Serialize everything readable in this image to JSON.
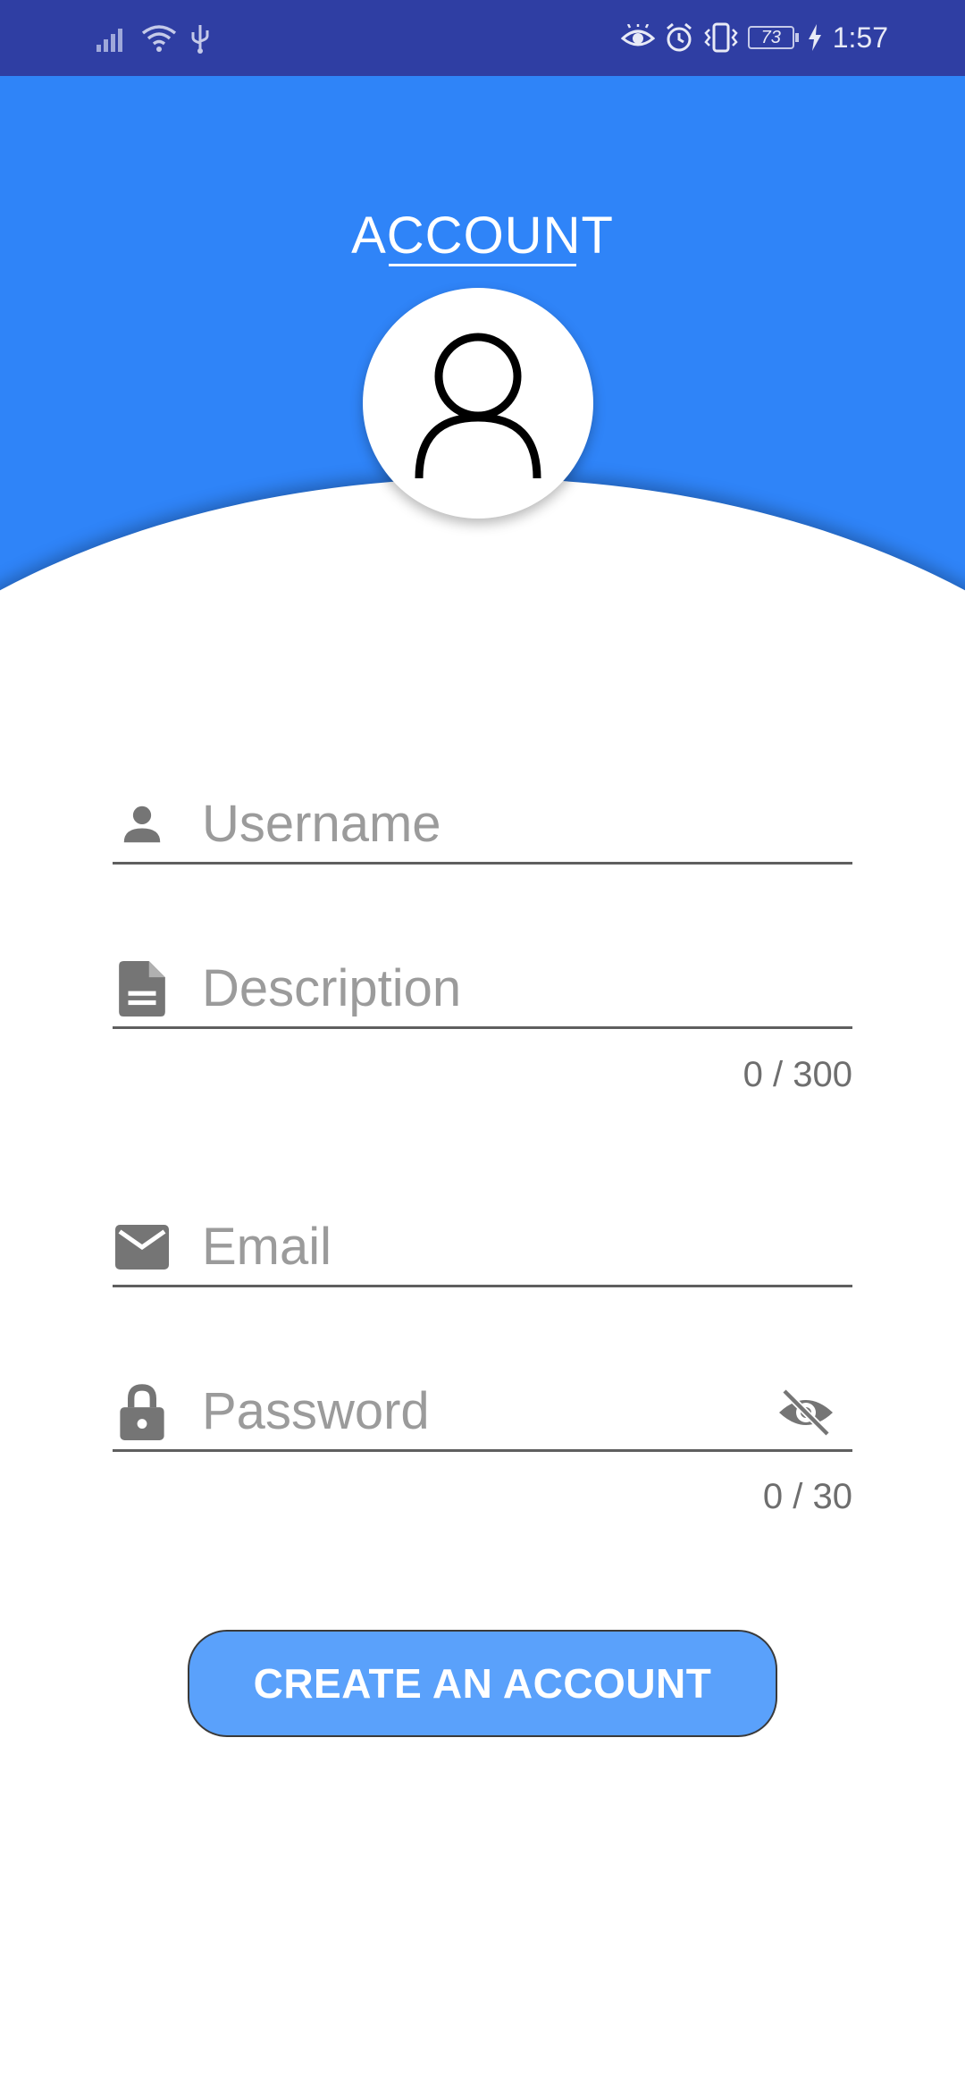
{
  "status_bar": {
    "time": "1:57",
    "battery": "73",
    "icons": [
      "signal-icon",
      "wifi-icon",
      "usb-icon",
      "eye-comfort-icon",
      "alarm-icon",
      "vibrate-icon",
      "battery-icon",
      "charging-icon"
    ]
  },
  "header": {
    "title": "ACCOUNT",
    "background_color": "#2f84f8",
    "avatar_icon": "person-outline-icon"
  },
  "form": {
    "username": {
      "placeholder": "Username",
      "value": "",
      "icon": "person-icon"
    },
    "description": {
      "placeholder": "Description",
      "value": "",
      "icon": "document-icon",
      "counter": "0 / 300"
    },
    "email": {
      "placeholder": "Email",
      "value": "",
      "icon": "mail-icon"
    },
    "password": {
      "placeholder": "Password",
      "value": "",
      "icon": "lock-icon",
      "toggle_icon": "visibility-off-icon",
      "counter": "0 / 30"
    }
  },
  "button": {
    "label": "CREATE AN ACCOUNT",
    "color": "#5aa1fb"
  }
}
